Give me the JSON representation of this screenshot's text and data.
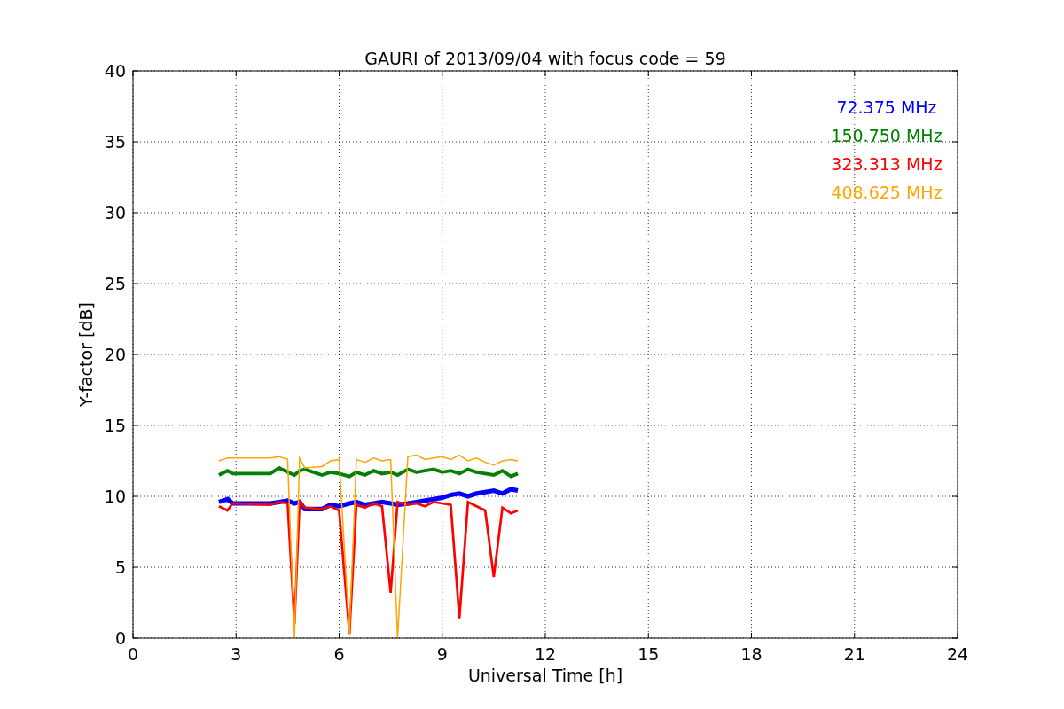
{
  "figure": {
    "chart_data": {
      "type": "line",
      "title": "GAURI of 2013/09/04 with focus code = 59",
      "xlabel": "Universal Time [h]",
      "ylabel": "Y-factor [dB]",
      "grid": true,
      "xlim": [
        0,
        24
      ],
      "ylim": [
        0,
        40
      ],
      "xticks": [
        0,
        3,
        6,
        9,
        12,
        15,
        18,
        21,
        24
      ],
      "yticks": [
        0,
        5,
        10,
        15,
        20,
        25,
        30,
        35,
        40
      ],
      "x": [
        2.5,
        2.75,
        2.9,
        4.0,
        4.25,
        4.5,
        4.7,
        4.85,
        5.0,
        5.5,
        5.75,
        6.0,
        6.3,
        6.5,
        6.75,
        7.0,
        7.25,
        7.5,
        7.7,
        8.0,
        8.25,
        8.5,
        8.75,
        9.0,
        9.25,
        9.5,
        9.75,
        10.0,
        10.25,
        10.5,
        10.75,
        11.0,
        11.2
      ],
      "series": [
        {
          "name": "72.375 MHz",
          "color": "#0000ff",
          "values": [
            9.6,
            9.8,
            9.5,
            9.5,
            9.6,
            9.7,
            9.5,
            9.6,
            9.1,
            9.1,
            9.4,
            9.3,
            9.5,
            9.6,
            9.4,
            9.5,
            9.6,
            9.5,
            9.4,
            9.5,
            9.6,
            9.7,
            9.8,
            9.9,
            10.1,
            10.2,
            10.0,
            10.2,
            10.3,
            10.4,
            10.2,
            10.5,
            10.4
          ]
        },
        {
          "name": "150.750 MHz",
          "color": "#008000",
          "values": [
            11.5,
            11.8,
            11.6,
            11.6,
            12.0,
            11.7,
            11.5,
            11.8,
            11.9,
            11.5,
            11.7,
            11.6,
            11.4,
            11.7,
            11.5,
            11.8,
            11.6,
            11.7,
            11.5,
            11.9,
            11.7,
            11.8,
            11.9,
            11.7,
            11.8,
            11.6,
            11.9,
            11.7,
            11.6,
            11.5,
            11.8,
            11.4,
            11.6
          ]
        },
        {
          "name": "323.313 MHz",
          "color": "#ff0000",
          "values": [
            9.3,
            9.0,
            9.5,
            9.4,
            9.6,
            9.5,
            1.0,
            9.6,
            9.2,
            9.1,
            9.3,
            9.0,
            0.3,
            9.4,
            9.2,
            9.5,
            9.3,
            3.2,
            9.6,
            9.4,
            9.5,
            9.3,
            9.6,
            9.5,
            9.4,
            1.4,
            9.6,
            9.3,
            9.0,
            4.3,
            9.2,
            8.8,
            9.0
          ]
        },
        {
          "name": "408.625 MHz",
          "color": "#ffa500",
          "values": [
            12.5,
            12.7,
            12.7,
            12.7,
            12.8,
            12.6,
            0.0,
            12.7,
            12.0,
            12.1,
            12.5,
            12.6,
            0.3,
            12.6,
            12.4,
            12.7,
            12.5,
            12.6,
            0.0,
            12.8,
            12.9,
            12.6,
            12.7,
            12.8,
            12.6,
            12.9,
            12.5,
            12.7,
            12.4,
            12.2,
            12.5,
            12.6,
            12.5
          ]
        }
      ]
    }
  }
}
